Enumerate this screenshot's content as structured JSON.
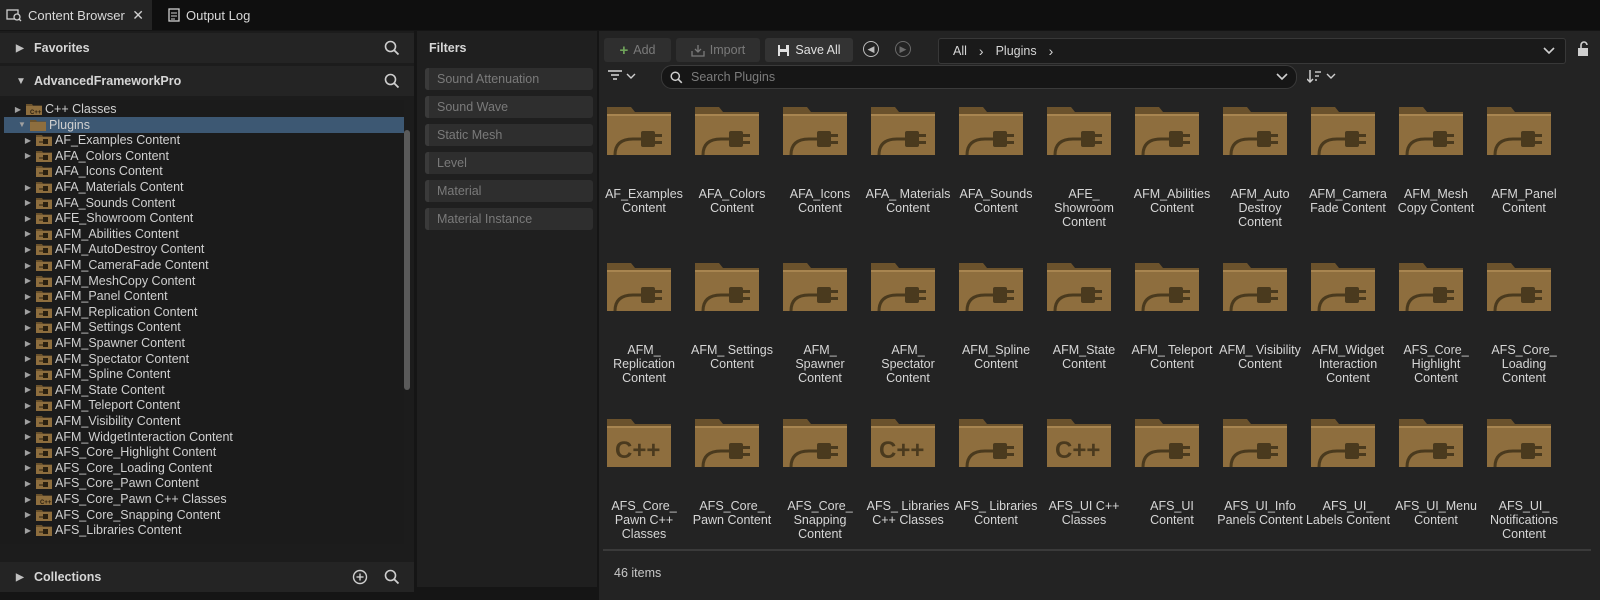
{
  "tabs": [
    {
      "label": "Content Browser",
      "icon": "content-browser-icon"
    },
    {
      "label": "Output Log",
      "icon": "output-log-icon"
    }
  ],
  "sources": {
    "favorites_label": "Favorites",
    "project_label": "AdvancedFrameworkPro",
    "collections_label": "Collections",
    "tree": [
      {
        "label": "C++ Classes",
        "kind": "cpp",
        "depth": 1,
        "expander": "right"
      },
      {
        "label": "Plugins",
        "kind": "open",
        "depth": 1,
        "expander": "down",
        "selected": true
      },
      {
        "label": "AF_Examples Content",
        "kind": "plugin",
        "depth": 2,
        "expander": "right"
      },
      {
        "label": "AFA_Colors Content",
        "kind": "plugin",
        "depth": 2,
        "expander": "right"
      },
      {
        "label": "AFA_Icons Content",
        "kind": "plugin",
        "depth": 2,
        "expander": "none"
      },
      {
        "label": "AFA_Materials Content",
        "kind": "plugin",
        "depth": 2,
        "expander": "right"
      },
      {
        "label": "AFA_Sounds Content",
        "kind": "plugin",
        "depth": 2,
        "expander": "right"
      },
      {
        "label": "AFE_Showroom Content",
        "kind": "plugin",
        "depth": 2,
        "expander": "right"
      },
      {
        "label": "AFM_Abilities Content",
        "kind": "plugin",
        "depth": 2,
        "expander": "right"
      },
      {
        "label": "AFM_AutoDestroy Content",
        "kind": "plugin",
        "depth": 2,
        "expander": "right"
      },
      {
        "label": "AFM_CameraFade Content",
        "kind": "plugin",
        "depth": 2,
        "expander": "right"
      },
      {
        "label": "AFM_MeshCopy Content",
        "kind": "plugin",
        "depth": 2,
        "expander": "right"
      },
      {
        "label": "AFM_Panel Content",
        "kind": "plugin",
        "depth": 2,
        "expander": "right"
      },
      {
        "label": "AFM_Replication Content",
        "kind": "plugin",
        "depth": 2,
        "expander": "right"
      },
      {
        "label": "AFM_Settings Content",
        "kind": "plugin",
        "depth": 2,
        "expander": "right"
      },
      {
        "label": "AFM_Spawner Content",
        "kind": "plugin",
        "depth": 2,
        "expander": "right"
      },
      {
        "label": "AFM_Spectator Content",
        "kind": "plugin",
        "depth": 2,
        "expander": "right"
      },
      {
        "label": "AFM_Spline Content",
        "kind": "plugin",
        "depth": 2,
        "expander": "right"
      },
      {
        "label": "AFM_State Content",
        "kind": "plugin",
        "depth": 2,
        "expander": "right"
      },
      {
        "label": "AFM_Teleport Content",
        "kind": "plugin",
        "depth": 2,
        "expander": "right"
      },
      {
        "label": "AFM_Visibility Content",
        "kind": "plugin",
        "depth": 2,
        "expander": "right"
      },
      {
        "label": "AFM_WidgetInteraction Content",
        "kind": "plugin",
        "depth": 2,
        "expander": "right"
      },
      {
        "label": "AFS_Core_Highlight Content",
        "kind": "plugin",
        "depth": 2,
        "expander": "right"
      },
      {
        "label": "AFS_Core_Loading Content",
        "kind": "plugin",
        "depth": 2,
        "expander": "right"
      },
      {
        "label": "AFS_Core_Pawn Content",
        "kind": "plugin",
        "depth": 2,
        "expander": "right"
      },
      {
        "label": "AFS_Core_Pawn C++ Classes",
        "kind": "cpp",
        "depth": 2,
        "expander": "right"
      },
      {
        "label": "AFS_Core_Snapping Content",
        "kind": "plugin",
        "depth": 2,
        "expander": "right"
      },
      {
        "label": "AFS_Libraries Content",
        "kind": "plugin",
        "depth": 2,
        "expander": "right"
      }
    ]
  },
  "filters": {
    "title": "Filters",
    "items": [
      "Sound Attenuation",
      "Sound Wave",
      "Static Mesh",
      "Level",
      "Material",
      "Material Instance"
    ]
  },
  "toolbar": {
    "add_label": "Add",
    "import_label": "Import",
    "save_all_label": "Save All"
  },
  "breadcrumb": [
    "All",
    "Plugins"
  ],
  "search": {
    "placeholder": "Search Plugins"
  },
  "items": [
    {
      "label": "AF_Examples Content",
      "kind": "plugin"
    },
    {
      "label": "AFA_Colors Content",
      "kind": "plugin"
    },
    {
      "label": "AFA_Icons Content",
      "kind": "plugin"
    },
    {
      "label": "AFA_ Materials Content",
      "kind": "plugin"
    },
    {
      "label": "AFA_Sounds Content",
      "kind": "plugin"
    },
    {
      "label": "AFE_ Showroom Content",
      "kind": "plugin"
    },
    {
      "label": "AFM_Abilities Content",
      "kind": "plugin"
    },
    {
      "label": "AFM_Auto Destroy Content",
      "kind": "plugin"
    },
    {
      "label": "AFM_Camera Fade Content",
      "kind": "plugin"
    },
    {
      "label": "AFM_Mesh Copy Content",
      "kind": "plugin"
    },
    {
      "label": "AFM_Panel Content",
      "kind": "plugin"
    },
    {
      "label": "AFM_ Replication Content",
      "kind": "plugin"
    },
    {
      "label": "AFM_ Settings Content",
      "kind": "plugin"
    },
    {
      "label": "AFM_ Spawner Content",
      "kind": "plugin"
    },
    {
      "label": "AFM_ Spectator Content",
      "kind": "plugin"
    },
    {
      "label": "AFM_Spline Content",
      "kind": "plugin"
    },
    {
      "label": "AFM_State Content",
      "kind": "plugin"
    },
    {
      "label": "AFM_ Teleport Content",
      "kind": "plugin"
    },
    {
      "label": "AFM_ Visibility Content",
      "kind": "plugin"
    },
    {
      "label": "AFM_Widget Interaction Content",
      "kind": "plugin"
    },
    {
      "label": "AFS_Core_ Highlight Content",
      "kind": "plugin"
    },
    {
      "label": "AFS_Core_ Loading Content",
      "kind": "plugin"
    },
    {
      "label": "AFS_Core_ Pawn C++ Classes",
      "kind": "cpp"
    },
    {
      "label": "AFS_Core_ Pawn Content",
      "kind": "plugin"
    },
    {
      "label": "AFS_Core_ Snapping Content",
      "kind": "plugin"
    },
    {
      "label": "AFS_ Libraries C++ Classes",
      "kind": "cpp"
    },
    {
      "label": "AFS_ Libraries Content",
      "kind": "plugin"
    },
    {
      "label": "AFS_UI C++ Classes",
      "kind": "cpp"
    },
    {
      "label": "AFS_UI Content",
      "kind": "plugin"
    },
    {
      "label": "AFS_UI_Info Panels Content",
      "kind": "plugin"
    },
    {
      "label": "AFS_UI_ Labels Content",
      "kind": "plugin"
    },
    {
      "label": "AFS_UI_Menu Content",
      "kind": "plugin"
    },
    {
      "label": "AFS_UI_ Notifications Content",
      "kind": "plugin"
    }
  ],
  "status": {
    "item_count": "46 items"
  },
  "colors": {
    "folder": "#8e6e3e",
    "folder_dark": "#6b522c",
    "selection": "#3d5873",
    "accent_add": "#6fa35a"
  }
}
